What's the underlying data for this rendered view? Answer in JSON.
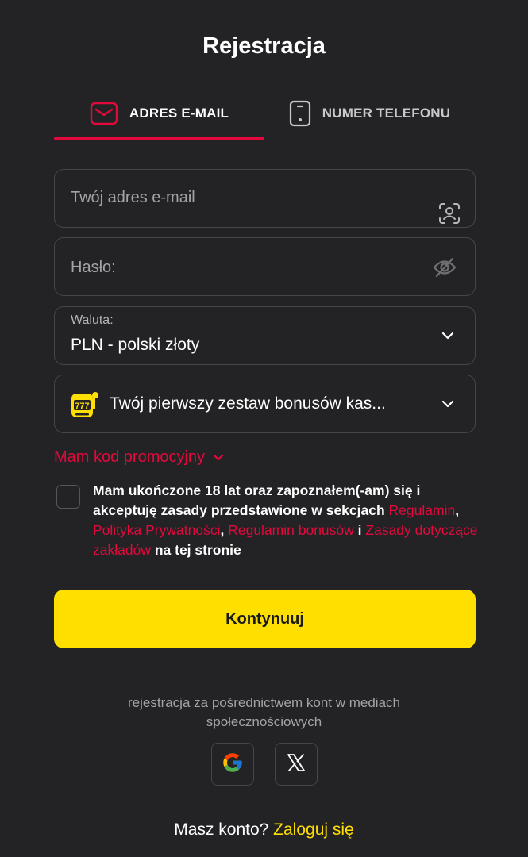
{
  "title": "Rejestracja",
  "tabs": [
    {
      "label": "ADRES E-MAIL",
      "icon": "envelope-icon",
      "active": true
    },
    {
      "label": "NUMER TELEFONU",
      "icon": "phone-icon",
      "active": false
    }
  ],
  "form": {
    "email_placeholder": "Twój adres e-mail",
    "password_placeholder": "Hasło:",
    "currency_label": "Waluta:",
    "currency_value": "PLN - polski złoty",
    "bonus_value": "Twój pierwszy zestaw bonusów kas..."
  },
  "promo": {
    "label": "Mam kod promocyjny"
  },
  "consent": {
    "text_1": "Mam ukończone 18 lat oraz zapoznałem(-am) się i akceptuję zasady przedstawione w sekcjach ",
    "link_regulamin": "Regulamin",
    "sep_1": ", ",
    "link_privacy": "Polityka Prywatności",
    "sep_2": ", ",
    "link_bonus_rules": "Regulamin bonusów",
    "sep_3": " i ",
    "link_betting_rules": "Zasady dotyczące zakładów",
    "text_2": " na tej stronie",
    "checked": false
  },
  "continue_label": "Kontynuuj",
  "social": {
    "text": "rejestracja za pośrednictwem kont w mediach społecznościowych",
    "providers": [
      "google-icon",
      "x-icon"
    ]
  },
  "login": {
    "prompt": "Masz konto? ",
    "link": "Zaloguj się"
  },
  "colors": {
    "background": "#232326",
    "accent_red": "#e3093c",
    "accent_yellow": "#ffdf00",
    "border": "#45454a",
    "muted_text": "#a3a3a8"
  }
}
